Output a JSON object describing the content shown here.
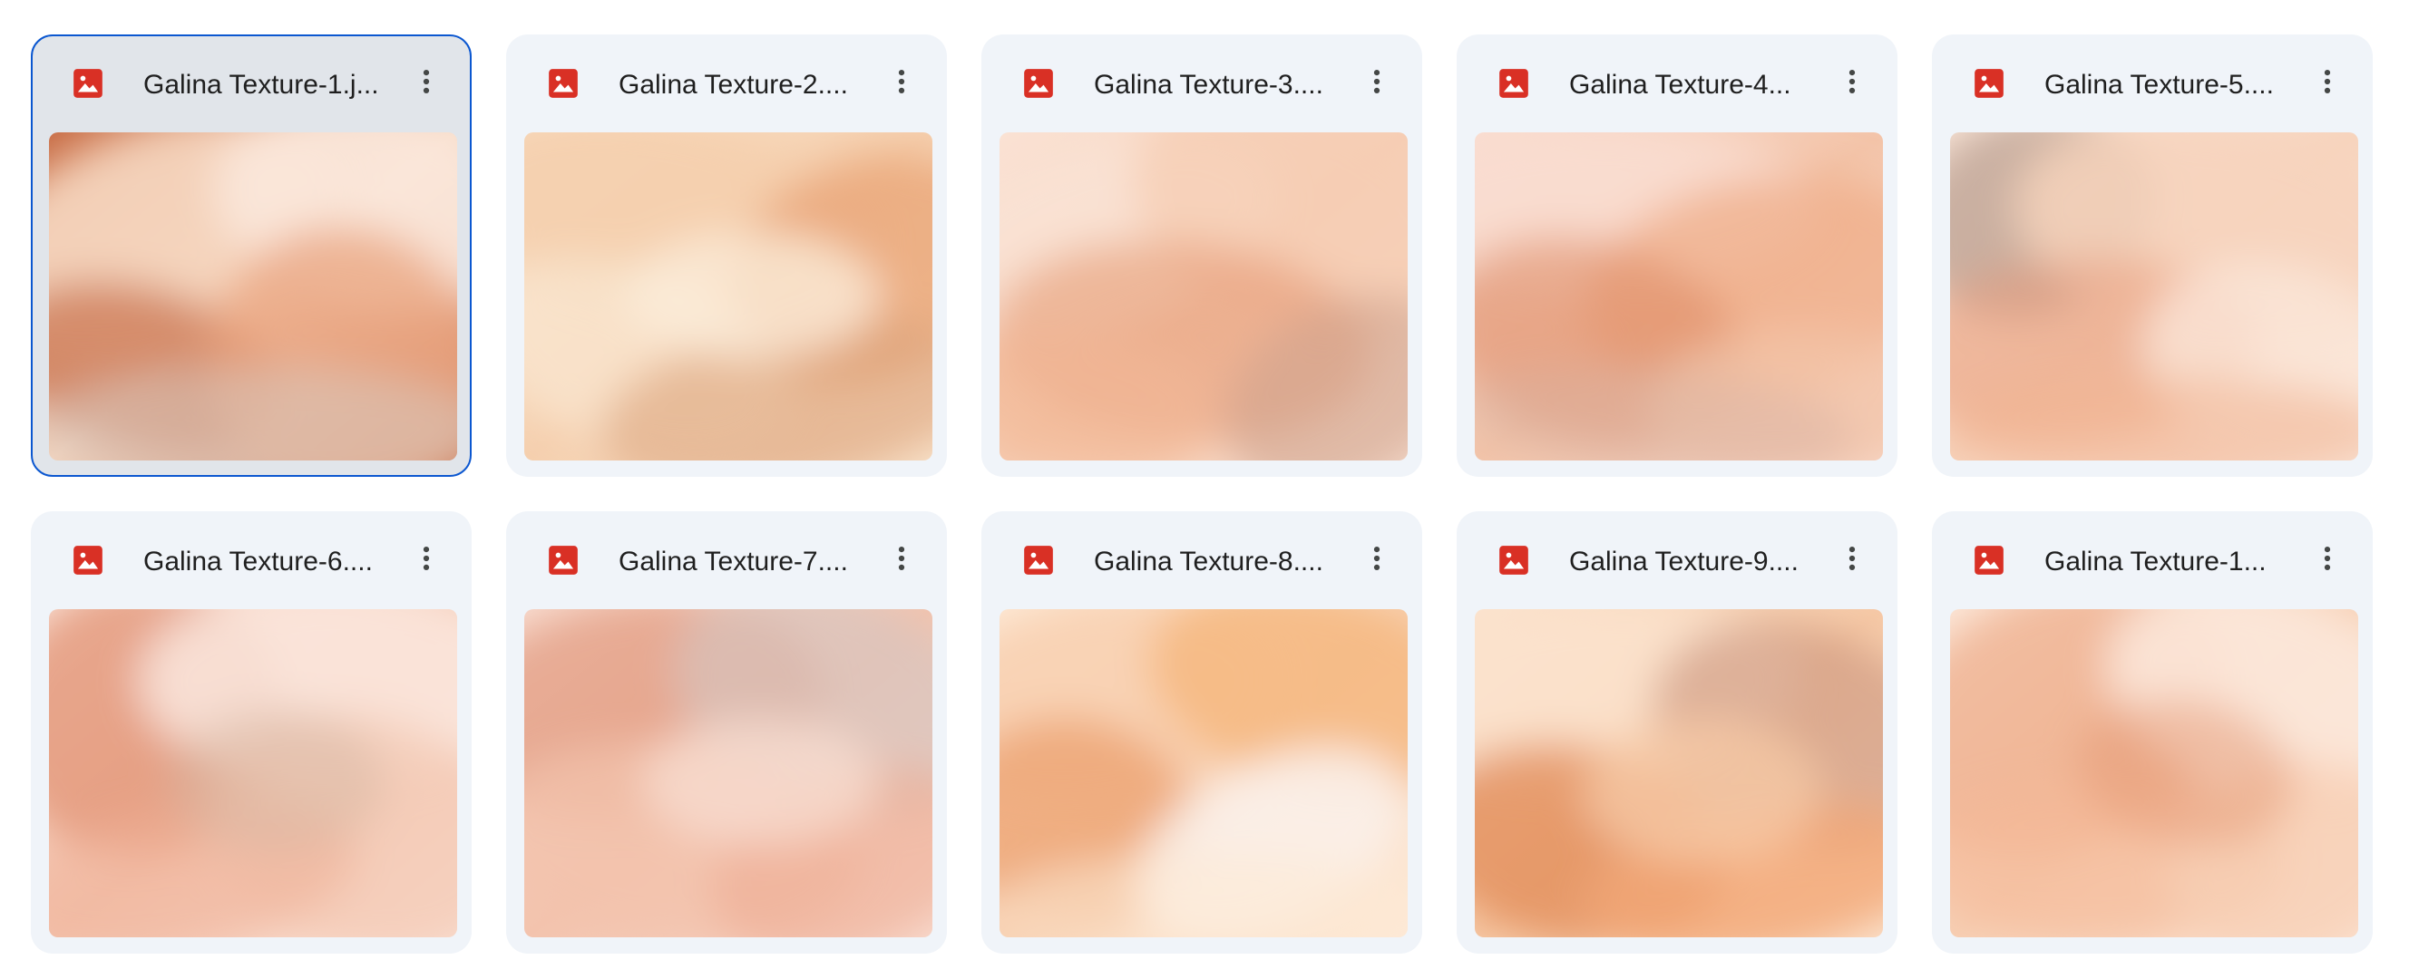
{
  "files": [
    {
      "name": "Galina Texture-1.j...",
      "selected": true,
      "icon": "image-file-icon",
      "palette": [
        "#f6d7c0",
        "#e9a37d",
        "#c96f48",
        "#fbe8dc",
        "#d9c7bc"
      ]
    },
    {
      "name": "Galina Texture-2....",
      "selected": false,
      "icon": "image-file-icon",
      "palette": [
        "#f5cfae",
        "#e8a070",
        "#f9e4cc",
        "#dca27a",
        "#fbecd9"
      ]
    },
    {
      "name": "Galina Texture-3....",
      "selected": false,
      "icon": "image-file-icon",
      "palette": [
        "#f6cdb4",
        "#e69b75",
        "#fae2d4",
        "#cfa18c",
        "#f2b896"
      ]
    },
    {
      "name": "Galina Texture-4...",
      "selected": false,
      "icon": "image-file-icon",
      "palette": [
        "#f3c4a9",
        "#e08d69",
        "#f9ddd0",
        "#d9b3a3",
        "#f0ab85"
      ]
    },
    {
      "name": "Galina Texture-5....",
      "selected": false,
      "icon": "image-file-icon",
      "palette": [
        "#f7d4bd",
        "#e79a7a",
        "#fbe7da",
        "#b59a8c",
        "#f1b595"
      ]
    },
    {
      "name": "Galina Texture-6....",
      "selected": false,
      "icon": "image-file-icon",
      "palette": [
        "#f4c8b2",
        "#e08c6c",
        "#fbe6dc",
        "#d7b7a4",
        "#f0b39a"
      ]
    },
    {
      "name": "Galina Texture-7....",
      "selected": false,
      "icon": "image-file-icon",
      "palette": [
        "#f3c3ad",
        "#dd8f73",
        "#f8dcd0",
        "#d7c5bf",
        "#eeae95"
      ]
    },
    {
      "name": "Galina Texture-8....",
      "selected": false,
      "icon": "image-file-icon",
      "palette": [
        "#f8d1b2",
        "#eb9c6a",
        "#fde9d6",
        "#f5b77d",
        "#fbf1ea"
      ]
    },
    {
      "name": "Galina Texture-9....",
      "selected": false,
      "icon": "image-file-icon",
      "palette": [
        "#f6c9a6",
        "#e0854f",
        "#fbe3ce",
        "#c9937a",
        "#f2a877"
      ]
    },
    {
      "name": "Galina Texture-1...",
      "selected": false,
      "icon": "image-file-icon",
      "palette": [
        "#f7d0b5",
        "#eba27d",
        "#fce8da",
        "#e59a75",
        "#f5bb9a"
      ]
    }
  ],
  "colors": {
    "pdf_red": "#d93025",
    "selection_border": "#0b57d0",
    "card_bg": "#f0f4f9",
    "selected_card_bg": "#e1e5ea"
  },
  "more_icon": "more-vert-icon"
}
